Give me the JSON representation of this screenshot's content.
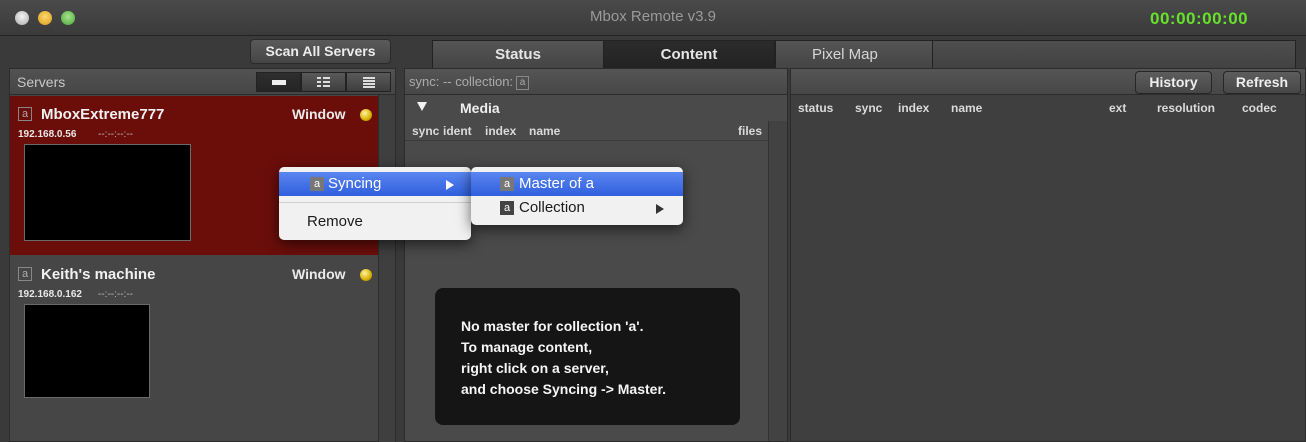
{
  "window": {
    "title": "Mbox Remote v3.9",
    "timecode": "00:00:00:00"
  },
  "toolbar": {
    "scan_label": "Scan All Servers",
    "tabs": [
      {
        "label": "Status"
      },
      {
        "label": "Content"
      },
      {
        "label": "Pixel Map"
      }
    ],
    "active_tab": "Content"
  },
  "servers": {
    "title": "Servers",
    "items": [
      {
        "badge": "a",
        "name": "MboxExtreme777",
        "ip": "192.168.0.56",
        "time": "--:--:--:--",
        "mode": "Window",
        "selected": true
      },
      {
        "badge": "a",
        "name": "Keith's machine",
        "ip": "192.168.0.162",
        "time": "--:--:--:--",
        "mode": "Window",
        "selected": false
      }
    ]
  },
  "media": {
    "sync_prefix": "sync: -- collection:",
    "collection_badge": "a",
    "section_label": "Media",
    "columns": [
      "sync",
      "ident",
      "index",
      "name",
      "files"
    ],
    "message": [
      "No master for collection 'a'.",
      "To manage content,",
      "right click on a server,",
      "and choose Syncing -> Master."
    ]
  },
  "content": {
    "history_label": "History",
    "refresh_label": "Refresh",
    "columns": [
      "status",
      "sync",
      "index",
      "name",
      "ext",
      "resolution",
      "codec"
    ]
  },
  "context_menu": {
    "items": [
      {
        "badge": "a",
        "label": "Syncing",
        "highlighted": true
      },
      {
        "label": "Remove"
      }
    ],
    "submenu": [
      {
        "badge": "a",
        "label": "Master of a",
        "highlighted": true
      },
      {
        "badge": "a",
        "label": "Collection",
        "has_submenu": true
      }
    ]
  },
  "colors": {
    "selected_server": "#6b0e0a",
    "timecode": "#66e22a",
    "menu_highlight": "#2f5fde",
    "status_led": "#d8b000"
  }
}
